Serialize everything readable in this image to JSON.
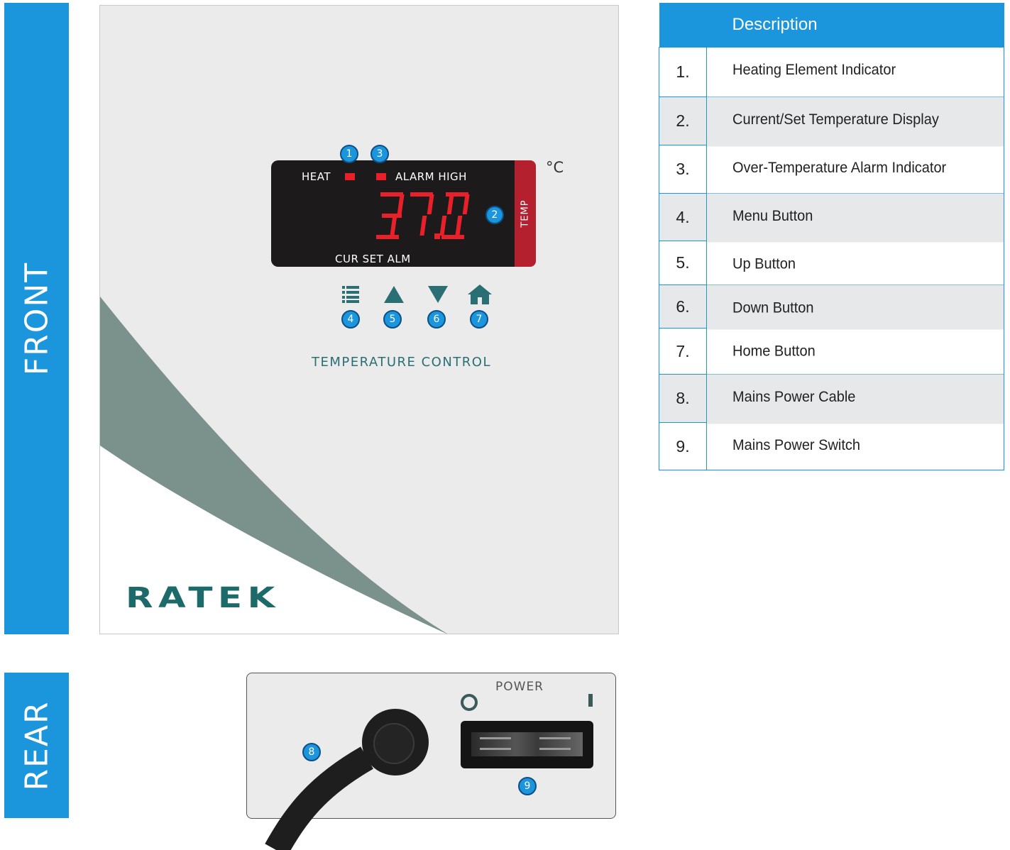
{
  "side_tabs": {
    "front": "FRONT",
    "rear": "REAR"
  },
  "front_panel": {
    "display": {
      "heat_label": "HEAT",
      "alarm_label": "ALARM HIGH",
      "reading": "37.0",
      "mode_labels": "CUR SET ALM",
      "side_label": "TEMP",
      "unit": "°C"
    },
    "keys": [
      {
        "icon": "menu-icon",
        "callout": "4"
      },
      {
        "icon": "up-arrow-icon",
        "callout": "5"
      },
      {
        "icon": "down-arrow-icon",
        "callout": "6"
      },
      {
        "icon": "home-icon",
        "callout": "7"
      }
    ],
    "callouts": {
      "heat": "1",
      "display": "2",
      "alarm": "3"
    },
    "title": "TEMPERATURE CONTROL",
    "brand": "RATEK"
  },
  "rear_panel": {
    "power_label": "POWER",
    "callouts": {
      "cable": "8",
      "switch": "9"
    }
  },
  "table": {
    "header": "Description",
    "rows": [
      {
        "num": "1.",
        "text": "Heating Element Indicator"
      },
      {
        "num": "2.",
        "text": "Current/Set Temperature Display"
      },
      {
        "num": "3.",
        "text": "Over-Temperature Alarm Indicator"
      },
      {
        "num": "4.",
        "text": "Menu Button"
      },
      {
        "num": "5.",
        "text": "Up Button"
      },
      {
        "num": "6.",
        "text": "Down Button"
      },
      {
        "num": "7.",
        "text": "Home Button"
      },
      {
        "num": "8.",
        "text": "Mains Power Cable"
      },
      {
        "num": "9.",
        "text": "Mains Power Switch"
      }
    ]
  },
  "colors": {
    "accent_blue": "#1b95dc",
    "display_red": "#e8202a",
    "teal": "#2a6f73",
    "swoosh": "#7a918c"
  }
}
